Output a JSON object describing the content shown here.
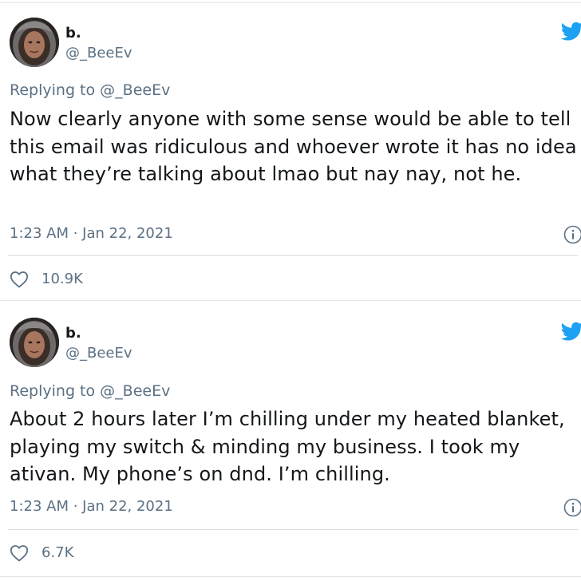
{
  "tweets": [
    {
      "display_name": "b.",
      "handle": "@_BeeEv",
      "replying_to": "Replying to @_BeeEv",
      "body": "Now clearly anyone with some sense would be able to tell this email was ridiculous and whoever wrote it has no idea what they’re talking about lmao but nay nay, not he.",
      "timestamp": "1:23 AM · Jan 22, 2021",
      "likes": "10.9K",
      "icons": {
        "brand": "twitter-bird-icon",
        "info": "info-icon",
        "like": "heart-icon"
      }
    },
    {
      "display_name": "b.",
      "handle": "@_BeeEv",
      "replying_to": "Replying to @_BeeEv",
      "body": "About 2 hours later I’m chilling under my heated blanket, playing my switch & minding my business. I took my ativan. My phone’s on dnd. I’m chilling.",
      "timestamp": "1:23 AM · Jan 22, 2021",
      "likes": "6.7K",
      "icons": {
        "brand": "twitter-bird-icon",
        "info": "info-icon",
        "like": "heart-icon"
      }
    }
  ],
  "colors": {
    "brand_blue": "#1da1f2",
    "secondary_text": "#5b7083",
    "primary_text": "#14171a",
    "divider": "#dfe5ea"
  }
}
